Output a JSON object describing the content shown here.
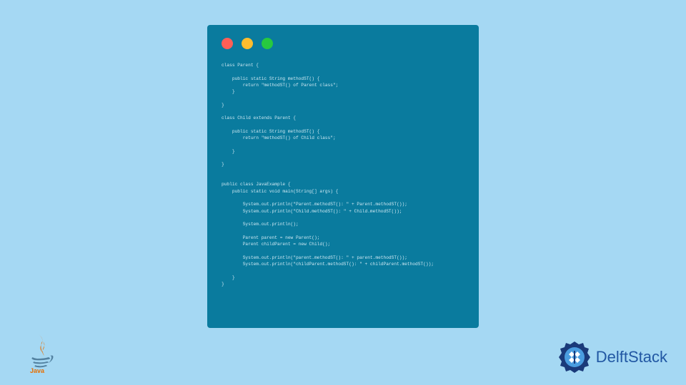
{
  "code": {
    "line1": "class Parent {",
    "line2": "    public static String methodST() {",
    "line3": "        return \"methodST() of Parent class\";",
    "line4": "    }",
    "line5": "}",
    "line6": "class Child extends Parent {",
    "line7": "    public static String methodST() {",
    "line8": "        return \"methodST() of Child class\";",
    "line9": "    }",
    "line10": "}",
    "line11": "public class JavaExample {",
    "line12": "    public static void main(String[] args) {",
    "line13": "        System.out.println(\"Parent.methodST(): \" + Parent.methodST());",
    "line14": "        System.out.println(\"Child.methodST(): \" + Child.methodST());",
    "line15": "        System.out.println();",
    "line16": "        Parent parent = new Parent();",
    "line17": "        Parent childParent = new Child();",
    "line18": "        System.out.println(\"parent.methodST(): \" + parent.methodST());",
    "line19": "        System.out.println(\"childParent.methodST(): \" + childParent.methodST());",
    "line20": "    }",
    "line21": "}"
  },
  "brand": {
    "name": "DelftStack"
  }
}
